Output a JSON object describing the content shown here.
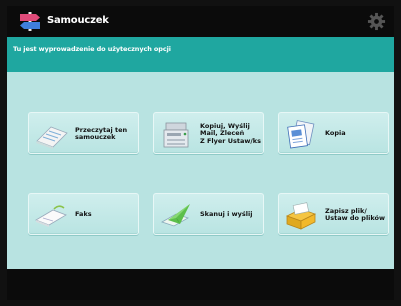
{
  "window": {
    "title": "Samouczek",
    "info_text": "Tu jest wyprowadzenie do użytecznych opcji"
  },
  "buttons": [
    {
      "label": "Przeczytaj ten\nsamouczek",
      "icon": "handbook-icon"
    },
    {
      "label": "Kopiuj, Wyślij\nMail, Zleceń\nZ Flyer Ustaw/ks",
      "icon": "copier-icon"
    },
    {
      "label": "Kopia",
      "icon": "copy-documents-icon"
    },
    {
      "label": "Faks",
      "icon": "fax-icon"
    },
    {
      "label": "Skanuj i wyślij",
      "icon": "scan-send-icon"
    },
    {
      "label": "Zapisz plik/\nUstaw do plików",
      "icon": "folder-box-icon"
    }
  ],
  "colors": {
    "titlebar": "#0b0b0b",
    "infobar": "#1fa7a0",
    "background": "#b8e3e1",
    "button": "#c6ebe9"
  }
}
